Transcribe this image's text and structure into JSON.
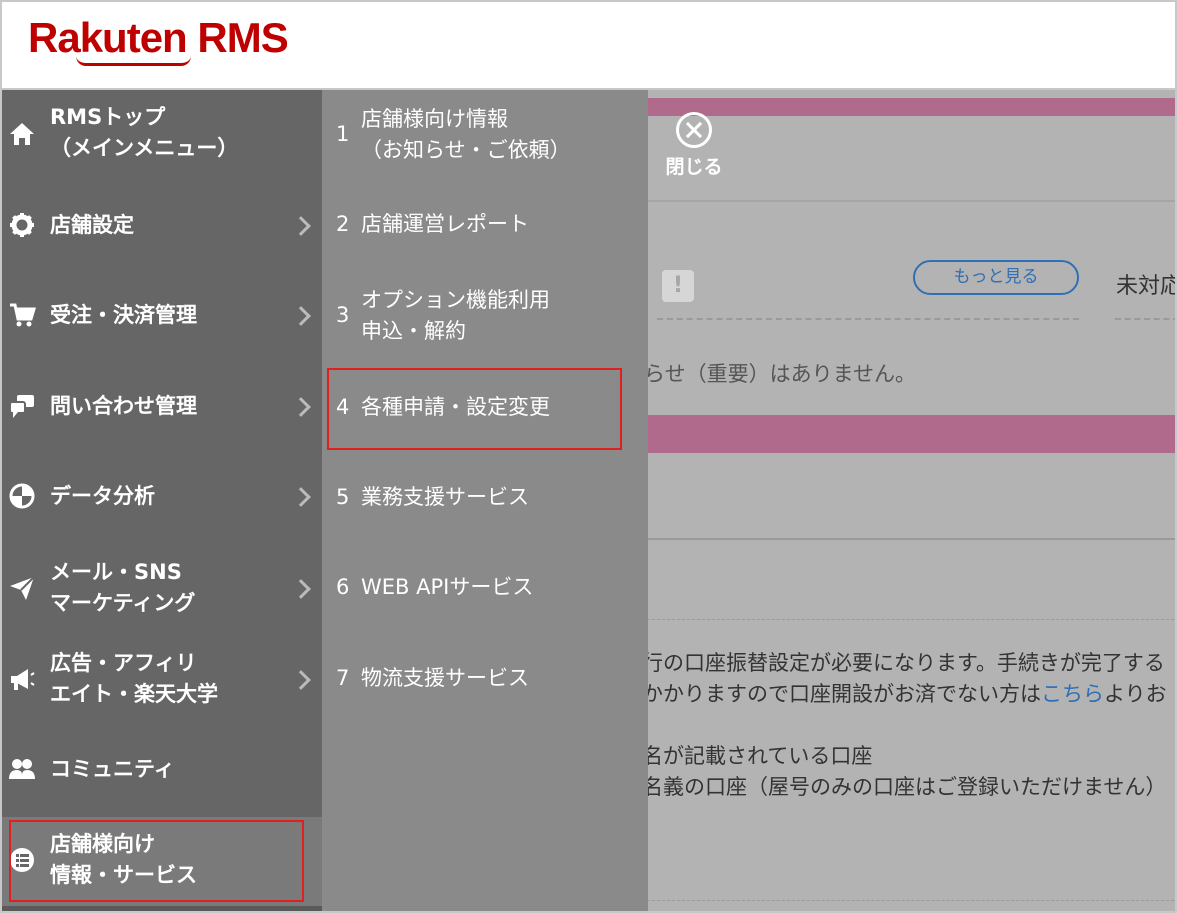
{
  "header": {
    "logo_text": "Rakuten RMS"
  },
  "background": {
    "close_label": "閉じる",
    "more_button": "もっと見る",
    "unresolved_label": "未対応",
    "notice_none": "らせ（重要）はありません。",
    "text_line1": "行の口座振替設定が必要になります。手続きが完了する",
    "text_line2a": "かかりますので口座開設がお済でない方は",
    "text_line2_link": "こちら",
    "text_line2b": "よりお",
    "text_line3": "名が記載されている口座",
    "text_line4": "名義の口座（屋号のみの口座はご登録いただけません）"
  },
  "menu_main": {
    "items": [
      {
        "line1": "RMSトップ",
        "line2": "（メインメニュー）",
        "icon": "home-icon"
      },
      {
        "line1": "店舗設定",
        "icon": "gear-icon"
      },
      {
        "line1": "受注・決済管理",
        "icon": "cart-icon"
      },
      {
        "line1": "問い合わせ管理",
        "icon": "chat-icon"
      },
      {
        "line1": "データ分析",
        "icon": "pie-chart-icon"
      },
      {
        "line1": "メール・SNS",
        "line2": "マーケティング",
        "icon": "paper-plane-icon"
      },
      {
        "line1": "広告・アフィリ",
        "line2": "エイト・楽天大学",
        "icon": "megaphone-icon"
      },
      {
        "line1": "コミュニティ",
        "icon": "people-icon"
      },
      {
        "line1": "店舗様向け",
        "line2": "情報・サービス",
        "icon": "list-icon"
      }
    ]
  },
  "menu_sub": {
    "items": [
      {
        "num": "1",
        "line1": "店舗様向け情報",
        "line2": "（お知らせ・ご依頼）"
      },
      {
        "num": "2",
        "line1": "店舗運営レポート"
      },
      {
        "num": "3",
        "line1": "オプション機能利用",
        "line2": "申込・解約"
      },
      {
        "num": "4",
        "line1": "各種申請・設定変更"
      },
      {
        "num": "5",
        "line1": "業務支援サービス"
      },
      {
        "num": "6",
        "line1": "WEB APIサービス"
      },
      {
        "num": "7",
        "line1": "物流支援サービス"
      }
    ]
  },
  "colors": {
    "brand": "#bf0000",
    "highlight": "#e02020",
    "band": "#b06b8c",
    "link": "#2f6fb5"
  }
}
